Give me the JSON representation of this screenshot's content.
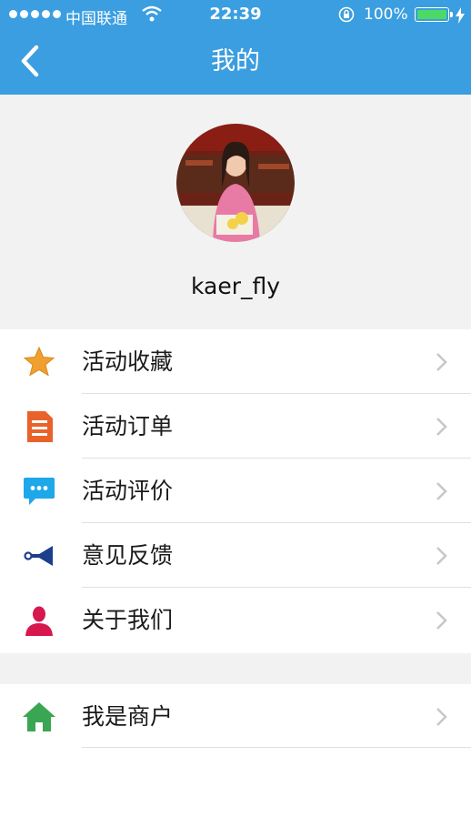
{
  "status_bar": {
    "carrier": "中国联通",
    "time": "22:39",
    "battery": "100%"
  },
  "nav": {
    "title": "我的",
    "back_icon": "chevron-left-icon"
  },
  "profile": {
    "username": "kaer_fly"
  },
  "menu": [
    {
      "label": "活动收藏",
      "icon": "star-icon"
    },
    {
      "label": "活动订单",
      "icon": "document-icon"
    },
    {
      "label": "活动评价",
      "icon": "chat-bubble-icon"
    },
    {
      "label": "意见反馈",
      "icon": "megaphone-icon"
    },
    {
      "label": "关于我们",
      "icon": "person-icon"
    }
  ],
  "merchant": {
    "label": "我是商户",
    "icon": "home-icon"
  },
  "colors": {
    "nav_bar": "#3b9ee0",
    "star": "#f0a030",
    "document": "#e8622a",
    "chat": "#1ea7e9",
    "megaphone": "#1c3f8c",
    "person": "#d6184f",
    "home": "#3aa653"
  }
}
